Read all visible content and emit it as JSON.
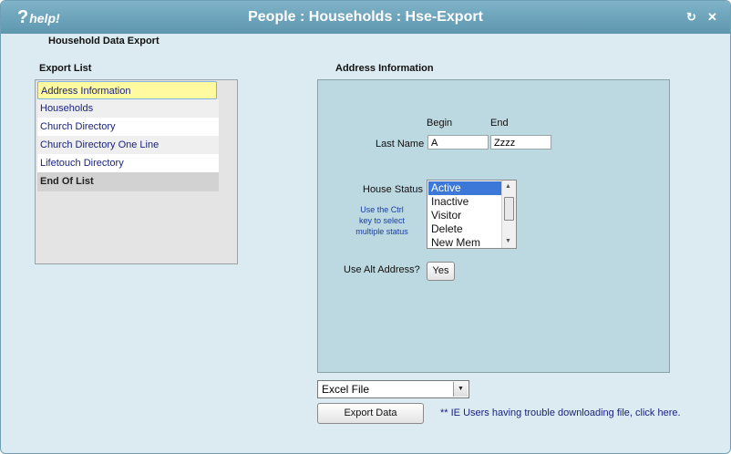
{
  "titlebar": {
    "help_logo": "help!",
    "title": "People : Households : Hse-Export",
    "refresh_icon": "refresh-icon",
    "close_icon": "close-icon"
  },
  "page_heading": "Household Data Export",
  "export_list": {
    "label": "Export List",
    "items": [
      {
        "label": "Address Information"
      },
      {
        "label": "Households"
      },
      {
        "label": "Church Directory"
      },
      {
        "label": "Church Directory One Line"
      },
      {
        "label": "Lifetouch Directory"
      },
      {
        "label": "End Of List"
      }
    ]
  },
  "address_info": {
    "label": "Address Information",
    "begin_label": "Begin",
    "end_label": "End",
    "last_name_label": "Last Name",
    "last_name_begin": "A",
    "last_name_end": "Zzzz",
    "house_status_label": "House Status",
    "house_status_hint": [
      "Use the Ctrl",
      "key to select",
      "multiple status"
    ],
    "house_status_options": [
      "Active",
      "Inactive",
      "Visitor",
      "Delete",
      "New Mem"
    ],
    "house_status_selected": "Active",
    "alt_address_label": "Use Alt Address?",
    "alt_address_button": "Yes"
  },
  "footer": {
    "format_selected": "Excel File",
    "export_button": "Export Data",
    "ie_link": "** IE Users having trouble downloading file, click here."
  },
  "colors": {
    "titlebar": "#6fa7bd",
    "panel": "#bcd8e1",
    "window_bg": "#dcebf2",
    "link_text": "#1a237e",
    "selection": "#3b78d8"
  }
}
